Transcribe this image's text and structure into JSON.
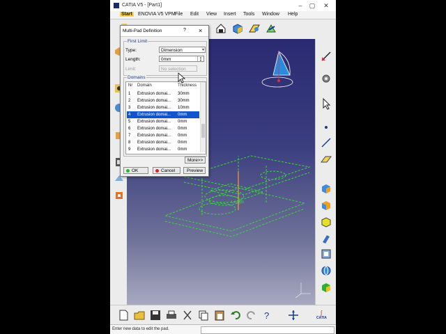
{
  "window": {
    "title": "CATIA V5 - [Part1]"
  },
  "menubar": {
    "items": [
      "Start",
      "ENOVIA V5 VPM",
      "File",
      "Edit",
      "View",
      "Insert",
      "Tools",
      "Window",
      "Help"
    ]
  },
  "dialog": {
    "title": "Multi-Pad Definition",
    "help_glyph": "?",
    "close_glyph": "×",
    "first_limit": {
      "group_label": "First Limit",
      "type_label": "Type:",
      "type_value": "Dimension",
      "length_label": "Length:",
      "length_value": "0mm",
      "limit_label": "Limit:",
      "limit_value": "No selection"
    },
    "domains": {
      "group_label": "Domains",
      "columns": [
        "Nr",
        "Domain",
        "Thickness"
      ],
      "rows": [
        {
          "nr": "1",
          "domain": "Extrusion domai...",
          "thickness": "30mm"
        },
        {
          "nr": "2",
          "domain": "Extrusion domai...",
          "thickness": "30mm"
        },
        {
          "nr": "3",
          "domain": "Extrusion domai...",
          "thickness": "10mm"
        },
        {
          "nr": "4",
          "domain": "Extrusion domai...",
          "thickness": "0mm"
        },
        {
          "nr": "5",
          "domain": "Extrusion domai...",
          "thickness": "0mm"
        },
        {
          "nr": "6",
          "domain": "Extrusion domai...",
          "thickness": "0mm"
        },
        {
          "nr": "7",
          "domain": "Extrusion domai...",
          "thickness": "0mm"
        },
        {
          "nr": "8",
          "domain": "Extrusion domai...",
          "thickness": "0mm"
        },
        {
          "nr": "9",
          "domain": "Extrusion domai...",
          "thickness": "0mm"
        }
      ],
      "selected_row": "4"
    },
    "more_label": "More>>",
    "ok_label": "OK",
    "cancel_label": "Cancel",
    "preview_label": "Preview"
  },
  "viewport": {
    "annotation_text": "Length"
  },
  "status": {
    "message": "Enter new data to edit the pad."
  },
  "brand": {
    "logo_text": "CATIA"
  },
  "colors": {
    "accent_green": "#33dd33",
    "selection_blue": "#1155cc",
    "start_menu": "#ffd34a"
  }
}
